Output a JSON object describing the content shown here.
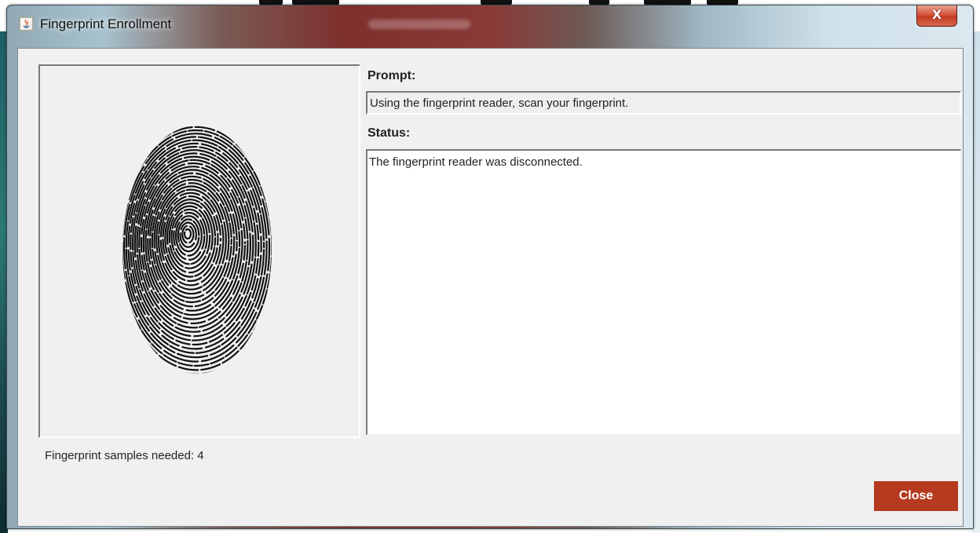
{
  "window": {
    "title": "Fingerprint Enrollment",
    "close_glyph": "X"
  },
  "prompt": {
    "label": "Prompt:",
    "value": "Using the fingerprint reader, scan your fingerprint."
  },
  "status": {
    "label": "Status:",
    "value": "The fingerprint reader was disconnected."
  },
  "samples_text": "Fingerprint samples needed: 4",
  "buttons": {
    "close_label": "Close"
  },
  "icons": {
    "title_icon": "java-app-icon",
    "fingerprint_image": "fingerprint-image"
  },
  "colors": {
    "close_button": "#b53a1f",
    "dialog_background": "#f0f0f0",
    "status_background": "#ffffff"
  }
}
